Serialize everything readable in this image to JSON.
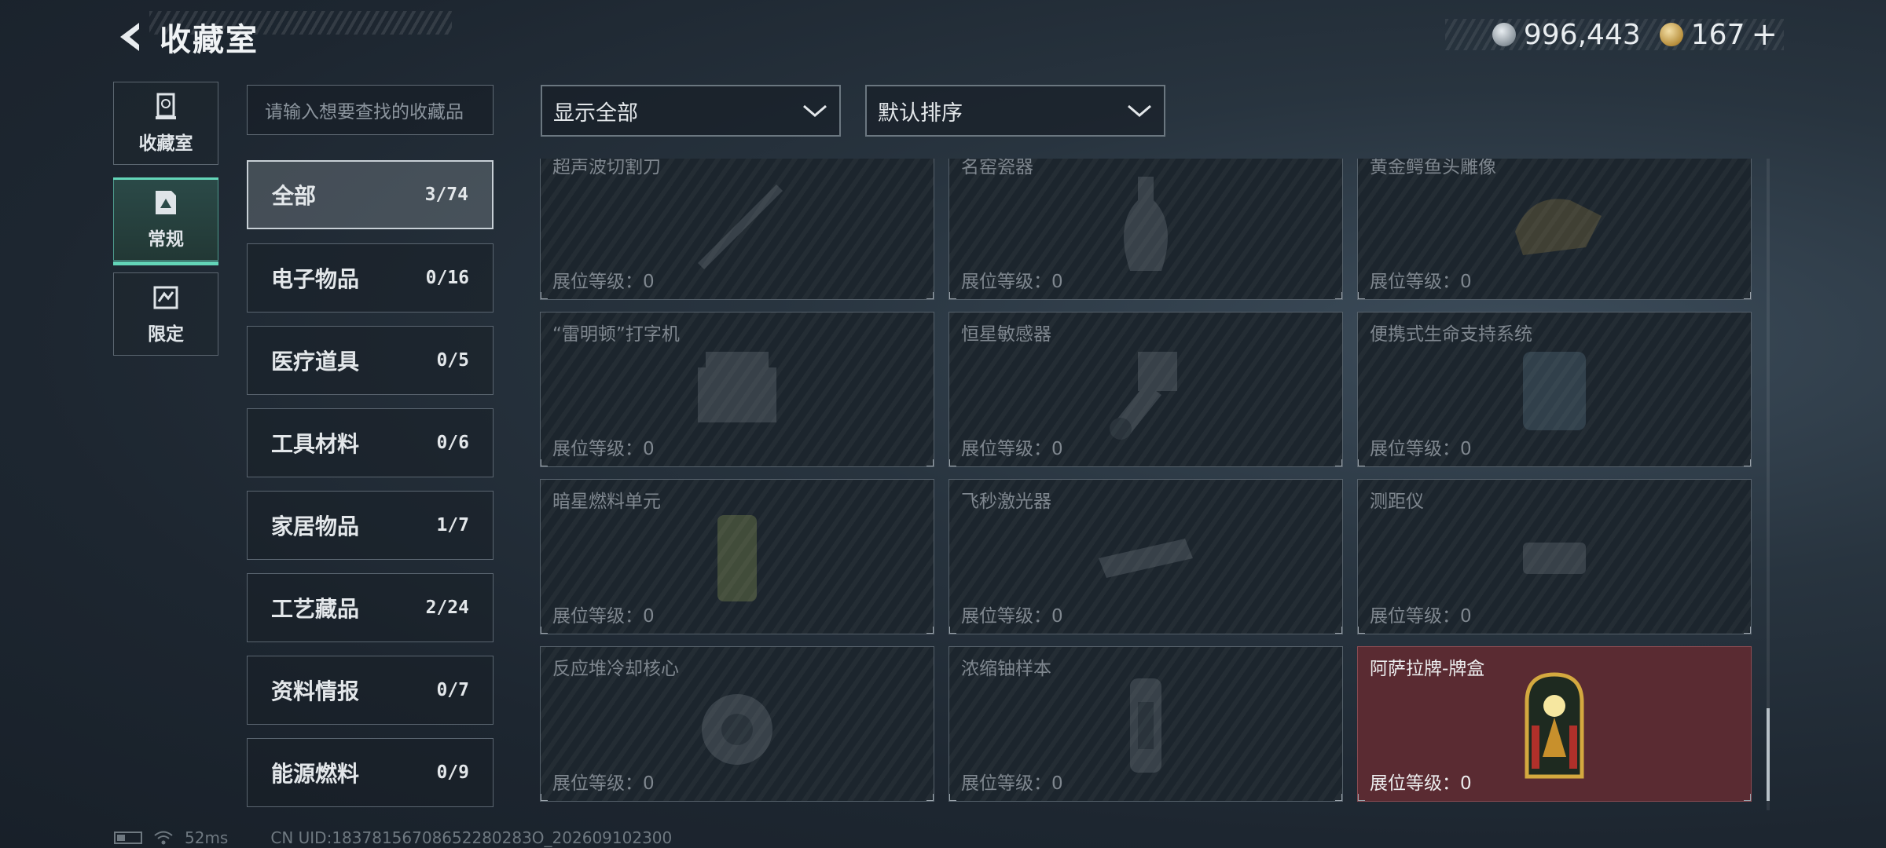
{
  "header": {
    "title": "收藏室"
  },
  "currency": {
    "silver": "996,443",
    "gold": "167",
    "plus": "+"
  },
  "side_tabs": [
    {
      "label": "收藏室",
      "icon": "trophy-icon"
    },
    {
      "label": "常规",
      "icon": "document-icon",
      "active": true
    },
    {
      "label": "限定",
      "icon": "limited-icon"
    }
  ],
  "search": {
    "placeholder": "请输入想要查找的收藏品"
  },
  "categories": [
    {
      "name": "全部",
      "count": "3/74",
      "active": true
    },
    {
      "name": "电子物品",
      "count": "0/16"
    },
    {
      "name": "医疗道具",
      "count": "0/5"
    },
    {
      "name": "工具材料",
      "count": "0/6"
    },
    {
      "name": "家居物品",
      "count": "1/7"
    },
    {
      "name": "工艺藏品",
      "count": "2/24"
    },
    {
      "name": "资料情报",
      "count": "0/7"
    },
    {
      "name": "能源燃料",
      "count": "0/9"
    }
  ],
  "filters": {
    "display": "显示全部",
    "sort": "默认排序"
  },
  "items": [
    {
      "name": "超声波切割刀",
      "level": "展位等级：0"
    },
    {
      "name": "名窑瓷器",
      "level": "展位等级：0"
    },
    {
      "name": "黄金鳄鱼头雕像",
      "level": "展位等级：0"
    },
    {
      "name": "“雷明顿”打字机",
      "level": "展位等级：0"
    },
    {
      "name": "恒星敏感器",
      "level": "展位等级：0"
    },
    {
      "name": "便携式生命支持系统",
      "level": "展位等级：0"
    },
    {
      "name": "暗星燃料单元",
      "level": "展位等级：0"
    },
    {
      "name": "飞秒激光器",
      "level": "展位等级：0"
    },
    {
      "name": "测距仪",
      "level": "展位等级：0"
    },
    {
      "name": "反应堆冷却核心",
      "level": "展位等级：0"
    },
    {
      "name": "浓缩铀样本",
      "level": "展位等级：0"
    },
    {
      "name": "阿萨拉牌-牌盒",
      "level": "展位等级：0",
      "owned": true
    }
  ],
  "footer": {
    "ping": "52ms",
    "uid": "CN UID:18378156708652280283O_202609102300"
  },
  "colors": {
    "accent": "#63d5b8",
    "owned_card": "#5a2b32"
  }
}
